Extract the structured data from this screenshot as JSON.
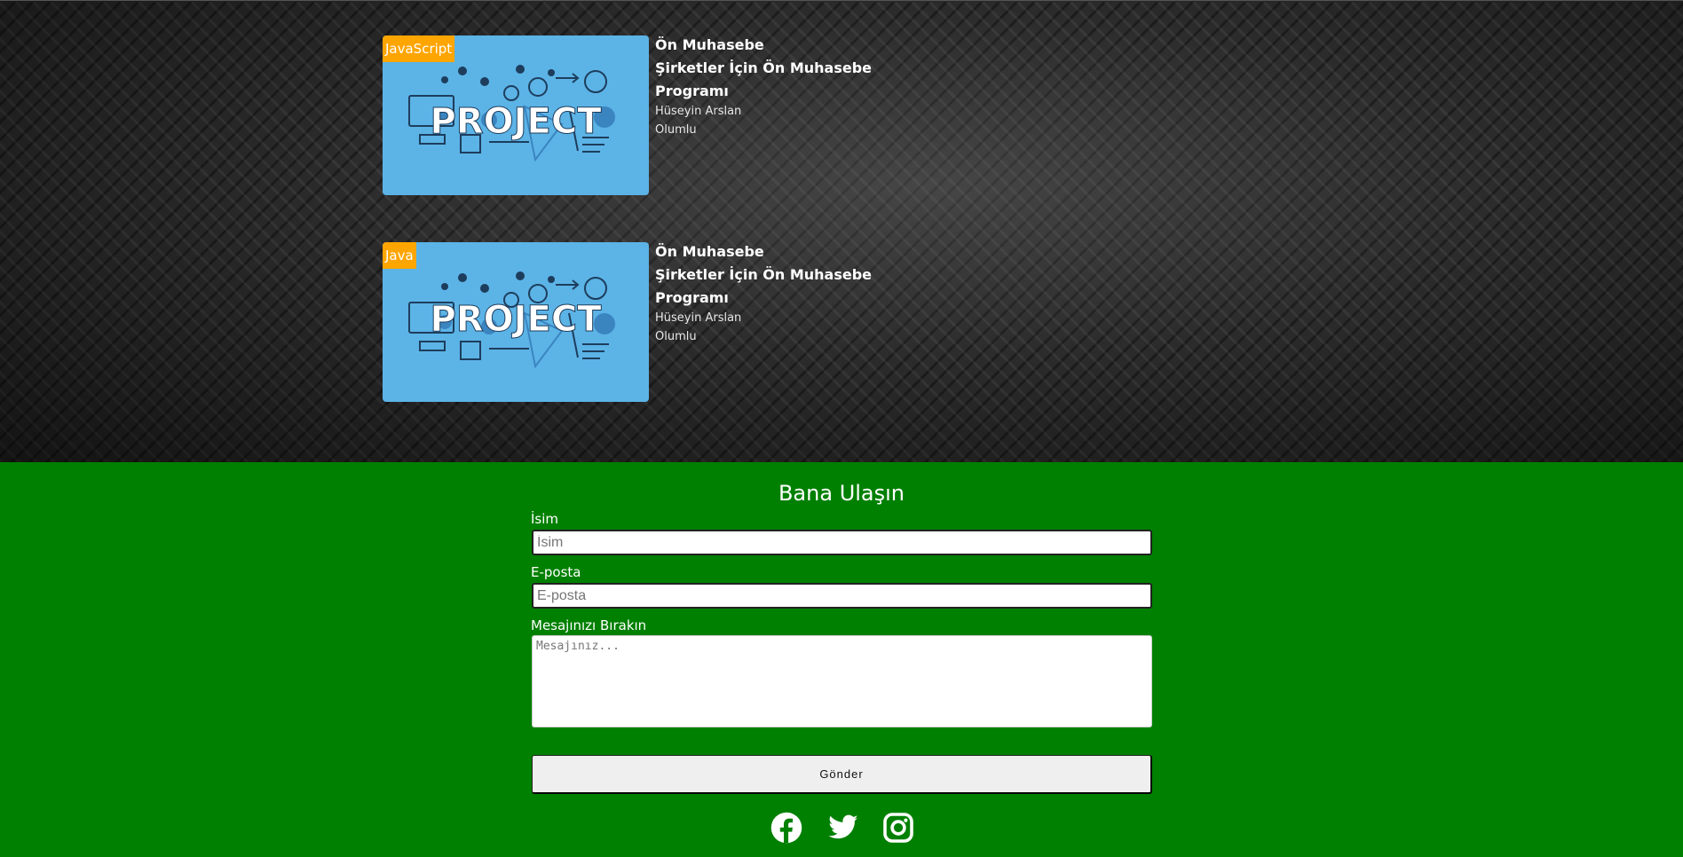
{
  "projects": [
    {
      "badge": "JavaScript",
      "category": "Ön Muhasebe",
      "title": "Şirketler İçin Ön Muhasebe Programı",
      "author": "Hüseyin Arslan",
      "status": "Olumlu",
      "image_text": "PROJECT"
    },
    {
      "badge": "Java",
      "category": "Ön Muhasebe",
      "title": "Şirketler İçin Ön Muhasebe Programı",
      "author": "Hüseyin Arslan",
      "status": "Olumlu",
      "image_text": "PROJECT"
    }
  ],
  "contact": {
    "heading": "Bana Ulaşın",
    "name_label": "İsim",
    "name_placeholder": "İsim",
    "email_label": "E-posta",
    "email_placeholder": "E-posta",
    "message_label": "Mesajınızı Bırakın",
    "message_placeholder": "Mesajınız...",
    "submit_label": "Gönder"
  },
  "social": [
    {
      "icon": "facebook-icon"
    },
    {
      "icon": "twitter-icon"
    },
    {
      "icon": "instagram-icon"
    }
  ],
  "colors": {
    "footer_bg": "#008000",
    "badge_bg": "#ffa500",
    "thumb_bg": "#5cb3e6"
  }
}
